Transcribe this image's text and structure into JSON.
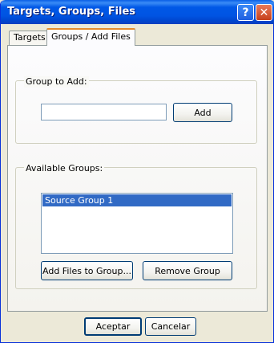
{
  "window": {
    "title": "Targets, Groups, Files",
    "help_glyph": "?",
    "close_glyph": "✕"
  },
  "tabs": [
    {
      "label": "Targets",
      "selected": false
    },
    {
      "label": "Groups / Add Files",
      "selected": true
    }
  ],
  "group_to_add": {
    "legend": "Group to Add:",
    "input_value": "",
    "add_label": "Add"
  },
  "available_groups": {
    "legend": "Available Groups:",
    "items": [
      {
        "label": "Source Group 1",
        "selected": true
      }
    ],
    "add_files_label": "Add Files to Group...",
    "remove_label": "Remove Group"
  },
  "footer": {
    "ok_label": "Aceptar",
    "cancel_label": "Cancelar"
  },
  "colors": {
    "title_bar": "#0054e3",
    "selection": "#316ac5",
    "dialog_bg": "#ece9d8"
  },
  "icons": {
    "help": "help-icon",
    "close": "close-icon"
  }
}
